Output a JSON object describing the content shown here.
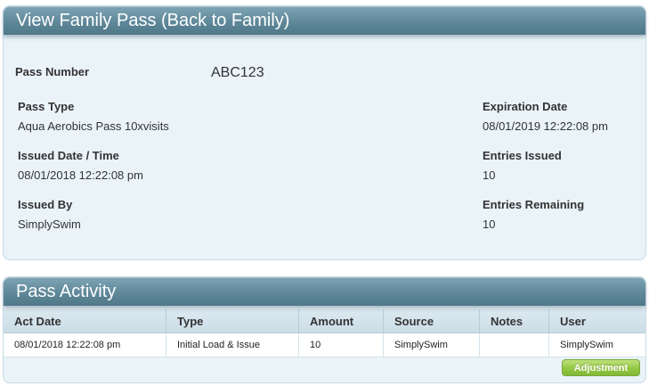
{
  "pass_panel": {
    "title": "View Family Pass (Back to Family)",
    "pass_number_label": "Pass Number",
    "pass_number_value": "ABC123",
    "pass_type_label": "Pass Type",
    "pass_type_value": "Aqua Aerobics Pass 10xvisits",
    "issued_label": "Issued Date / Time",
    "issued_value": "08/01/2018 12:22:08 pm",
    "issued_by_label": "Issued By",
    "issued_by_value": "SimplySwim",
    "expiration_label": "Expiration Date",
    "expiration_value": "08/01/2019 12:22:08 pm",
    "entries_issued_label": "Entries Issued",
    "entries_issued_value": "10",
    "entries_remaining_label": "Entries Remaining",
    "entries_remaining_value": "10"
  },
  "activity_panel": {
    "title": "Pass Activity",
    "columns": [
      "Act Date",
      "Type",
      "Amount",
      "Source",
      "Notes",
      "User"
    ],
    "rows": [
      [
        "08/01/2018 12:22:08 pm",
        "Initial Load & Issue",
        "10",
        "SimplySwim",
        "",
        "SimplySwim"
      ]
    ],
    "adjustment_label": "Adjustment"
  },
  "colors": {
    "header_bg": "#5f8899",
    "panel_bg": "#e9f3f8",
    "button_green": "#93c744"
  }
}
